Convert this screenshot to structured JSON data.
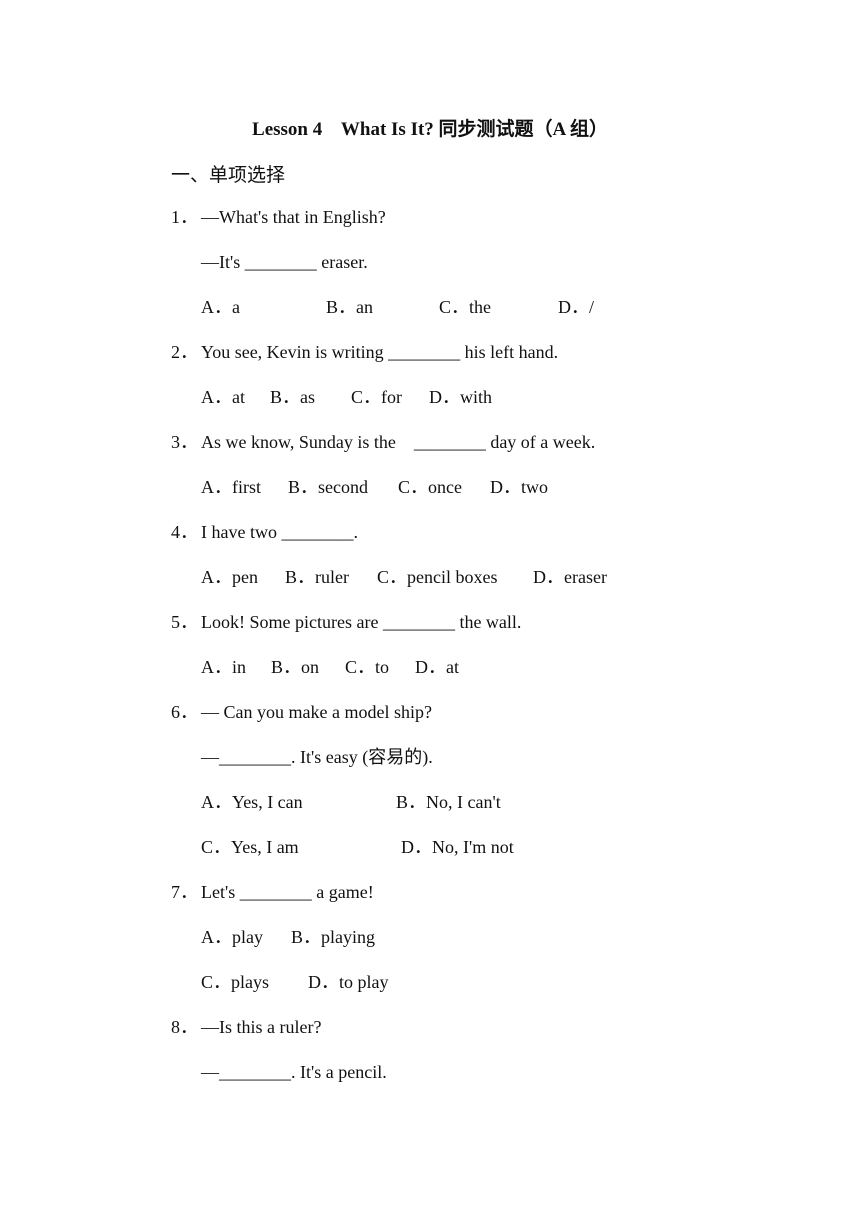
{
  "title": "Lesson 4    What Is It? 同步测试题（A 组）",
  "section": "一、单项选择",
  "questions": [
    {
      "num": "1．",
      "lines": [
        "—What's that in English?",
        "—It's ________ eraser."
      ],
      "options": [
        "A．a",
        "B．an",
        "C．the",
        "D．/"
      ]
    },
    {
      "num": "2．",
      "lines": [
        "You see, Kevin is writing ________ his left hand."
      ],
      "options": [
        "A．at",
        "B．as",
        "C．for",
        "D．with"
      ]
    },
    {
      "num": "3．",
      "lines": [
        "As we know, Sunday is the    ________ day of a week."
      ],
      "options": [
        "A．first",
        "B．second",
        "C．once",
        "D．two"
      ]
    },
    {
      "num": "4．",
      "lines": [
        "I have two ________."
      ],
      "options": [
        "A．pen",
        "B．ruler",
        "C．pencil boxes",
        "D．eraser"
      ]
    },
    {
      "num": "5．",
      "lines": [
        "Look! Some pictures are ________ the wall."
      ],
      "options": [
        "A．in",
        "B．on",
        "C．to",
        "D．at"
      ]
    },
    {
      "num": "6．",
      "lines": [
        "— Can you make a model ship?",
        "—________. It's easy (容易的)."
      ],
      "options": [
        "A．Yes, I can",
        "B．No, I can't",
        "C．Yes, I am",
        "D．No, I'm not"
      ]
    },
    {
      "num": "7．",
      "lines": [
        "Let's ________ a game!"
      ],
      "options": [
        "A．play",
        "B．playing",
        "C．plays",
        "D．to play"
      ]
    },
    {
      "num": "8．",
      "lines": [
        "—Is this a ruler?",
        "—________. It's a pencil."
      ],
      "options": []
    }
  ]
}
